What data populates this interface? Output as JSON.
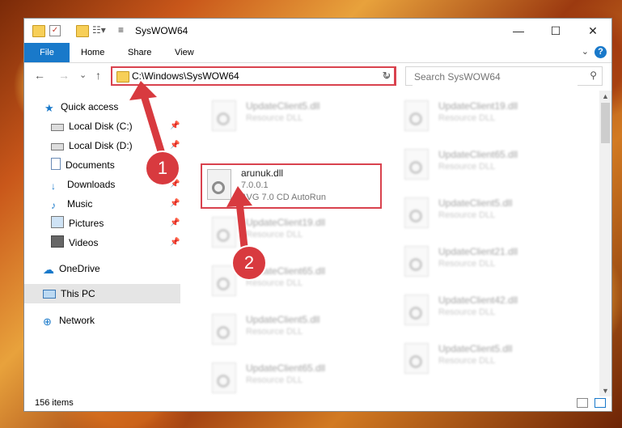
{
  "window": {
    "title": "SysWOW64",
    "controls": {
      "minimize": "—",
      "maximize": "☐",
      "close": "✕"
    }
  },
  "ribbon": {
    "tabs": [
      "File",
      "Home",
      "Share",
      "View"
    ],
    "help": "?"
  },
  "navbar": {
    "back": "←",
    "forward": "→",
    "recent": "⌄",
    "up": "↑",
    "address": "C:\\Windows\\SysWOW64",
    "refresh": "↻",
    "search_placeholder": "Search SysWOW64"
  },
  "sidebar": {
    "quick_access": "Quick access",
    "items": [
      {
        "label": "Local Disk (C:)",
        "icon": "drive-icon",
        "pinned": true
      },
      {
        "label": "Local Disk (D:)",
        "icon": "drive-icon",
        "pinned": true
      },
      {
        "label": "Documents",
        "icon": "documents-icon",
        "pinned": true
      },
      {
        "label": "Downloads",
        "icon": "downloads-icon",
        "pinned": true
      },
      {
        "label": "Music",
        "icon": "music-icon",
        "pinned": true
      },
      {
        "label": "Pictures",
        "icon": "pictures-icon",
        "pinned": true
      },
      {
        "label": "Videos",
        "icon": "videos-icon",
        "pinned": true
      }
    ],
    "onedrive": "OneDrive",
    "this_pc": "This PC",
    "network": "Network"
  },
  "files": {
    "selected": {
      "name": "arunuk.dll",
      "version": "7.0.0.1",
      "description": "AVG 7.0 CD AutoRun"
    },
    "left_column": [
      {
        "name": "UpdateClient5.dll",
        "type": "Resource DLL"
      },
      {
        "name": "UpdateClient19.dll",
        "type": "Resource DLL"
      },
      {
        "name": "UpdateClient65.dll",
        "type": "Resource DLL"
      },
      {
        "name": "UpdateClient5.dll",
        "type": "Resource DLL"
      },
      {
        "name": "UpdateClient65.dll",
        "type": "Resource DLL"
      }
    ],
    "right_column": [
      {
        "name": "UpdateClient19.dll",
        "type": "Resource DLL"
      },
      {
        "name": "UpdateClient65.dll",
        "type": "Resource DLL"
      },
      {
        "name": "UpdateClient5.dll",
        "type": "Resource DLL"
      },
      {
        "name": "UpdateClient21.dll",
        "type": "Resource DLL"
      },
      {
        "name": "UpdateClient42.dll",
        "type": "Resource DLL"
      },
      {
        "name": "UpdateClient5.dll",
        "type": "Resource DLL"
      }
    ]
  },
  "status": {
    "item_count": "156 items"
  },
  "annotations": {
    "step1": "1",
    "step2": "2"
  },
  "colors": {
    "accent": "#1979ca",
    "highlight": "#d9424e",
    "annotation": "#d83a3f"
  }
}
